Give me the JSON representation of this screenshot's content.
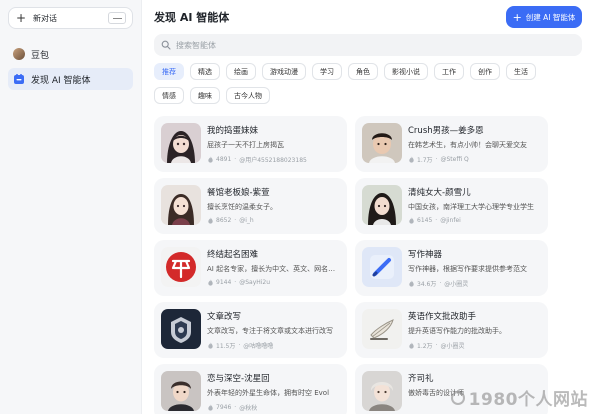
{
  "sidebar": {
    "new_chat_label": "新对话",
    "items": [
      {
        "label": "豆包",
        "icon": "avatar-icon"
      },
      {
        "label": "发现 AI 智能体",
        "icon": "agent-icon"
      }
    ]
  },
  "header": {
    "title": "发现 AI 智能体",
    "create_label": "创建 AI 智能体"
  },
  "search": {
    "placeholder": "搜索智能体"
  },
  "categories": [
    "推荐",
    "精选",
    "绘画",
    "游戏动漫",
    "学习",
    "角色",
    "影视小说",
    "工作",
    "创作",
    "生活",
    "情感",
    "趣味",
    "古今人物"
  ],
  "active_category": "推荐",
  "agents": [
    {
      "name": "我的捣蛋妹妹",
      "desc": "屁孩子一天不打上房揭瓦",
      "count": "4891",
      "author": "@用户4552188023185"
    },
    {
      "name": "Crush男孩—姜多恩",
      "desc": "在韩艺术生，有点小帅！会聊天爱交友",
      "count": "1.7万",
      "author": "@Steffi Q"
    },
    {
      "name": "餐馆老板娘-紫萱",
      "desc": "擅长烹饪的温柔女子。",
      "count": "8652",
      "author": "@i_h"
    },
    {
      "name": "清纯女大-颜雪儿",
      "desc": "中国女孩，南洋理工大学心理学专业学生",
      "count": "6145",
      "author": "@jinfei"
    },
    {
      "name": "终结起名困难",
      "desc": "AI 起名专家，擅长为中文、英文、网名起名",
      "count": "9144",
      "author": "@SayHi2u"
    },
    {
      "name": "写作神器",
      "desc": "写作神器，根据写作要求提供参考范文",
      "count": "34.6万",
      "author": "@小圈灵"
    },
    {
      "name": "文章改写",
      "desc": "文章改写，专注于将文章或文本进行改写",
      "count": "11.5万",
      "author": "@咕噜噜噜"
    },
    {
      "name": "英语作文批改助手",
      "desc": "提升英语写作能力的批改助手。",
      "count": "1.2万",
      "author": "@小圈灵"
    },
    {
      "name": "恋与深空-沈星回",
      "desc": "外表年轻的外星生命体，拥有时空 Evol",
      "count": "7946",
      "author": "@秋秋"
    },
    {
      "name": "齐司礼",
      "desc": "傲娇毒舌的设计师",
      "count": "",
      "author": ""
    }
  ],
  "watermark": "1980个人网站",
  "colors": {
    "accent": "#3b6cf5",
    "chip_active_bg": "#e7eefc",
    "card_bg": "#f5f6f8"
  }
}
